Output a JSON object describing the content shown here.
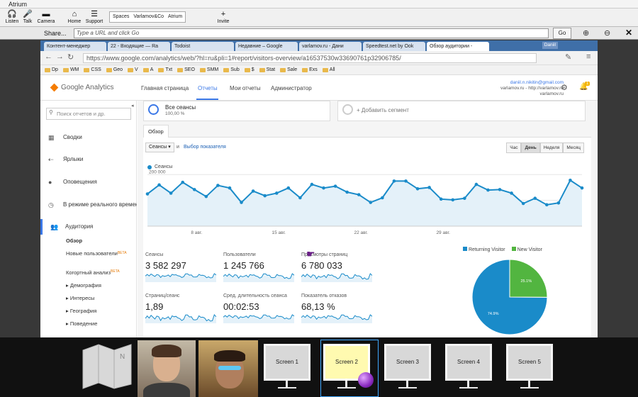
{
  "app": {
    "title": "Atrium",
    "toolbar": [
      "Listen",
      "Talk",
      "Camera",
      "Home",
      "Support",
      "Invite"
    ],
    "breadcrumb": [
      "Spaces",
      "Varlamov&Co",
      "Atrium"
    ],
    "share_label": "Share...",
    "url_placeholder": "Type a URL and click Go",
    "go_label": "Go"
  },
  "browser": {
    "tabs": [
      "Контент-менеджер",
      "22 - Входящие — Ra",
      "Todoist",
      "Недавние – Google",
      "varlamov.ru - Дани",
      "Speedtest.net by Ook",
      "Обзор аудитории -"
    ],
    "active_tab_index": 6,
    "user_badge": "Daniil",
    "url": "https://www.google.com/analytics/web/?hl=ru&pli=1#report/visitors-overview/a16537530w33690761p32906785/",
    "url_scheme": "https://",
    "bookmarks": [
      "Dp",
      "WM",
      "CSS",
      "Geo",
      "V",
      "A",
      "Txt",
      "SEO",
      "SMM",
      "Sub",
      "$",
      "Stat",
      "Sale",
      "Exs",
      "All"
    ]
  },
  "ga": {
    "logo_text": "Google Analytics",
    "nav": [
      "Главная страница",
      "Отчеты",
      "Мои отчеты",
      "Администратор"
    ],
    "active_nav": "Отчеты",
    "account": {
      "email": "daniil.n.nikitin@gmail.com",
      "property": "varlamov.ru - http://varlamov.ru",
      "view": "varlamov.ru"
    },
    "notification_count": "1",
    "sidebar": {
      "search_placeholder": "Поиск отчетов и др.",
      "items": [
        "Сводки",
        "Ярлыки",
        "Оповещения",
        "В режиме реального времени",
        "Аудитория"
      ],
      "sub_items": [
        "Обзор",
        "Новые пользователи",
        "Когортный анализ",
        "Демография",
        "Интересы",
        "География",
        "Поведение"
      ],
      "beta": "BETA"
    },
    "segment": {
      "title": "Все сеансы",
      "percent": "100,00 %",
      "add_label": "+ Добавить сегмент"
    },
    "overview_tab": "Обзор",
    "metric_select": "Сеансы",
    "and_label": "и",
    "choose_metric": "Выбор показателя",
    "time_buttons": [
      "Час",
      "День",
      "Неделя",
      "Месяц"
    ],
    "active_time": "День",
    "metrics": [
      {
        "label": "Сеансы",
        "value": "3 582 297"
      },
      {
        "label": "Пользователи",
        "value": "1 245 766"
      },
      {
        "label": "Просмотры страниц",
        "value": "6 780 033"
      },
      {
        "label": "Страниц/сеанс",
        "value": "1,89"
      },
      {
        "label": "Сред. длительность сеанса",
        "value": "00:02:53"
      },
      {
        "label": "Показатель отказов",
        "value": "68,13 %"
      }
    ],
    "pie": {
      "legend": [
        "Returning Visitor",
        "New Visitor"
      ],
      "values": [
        74.9,
        25.1
      ],
      "labels": [
        "74.9%",
        "25.1%"
      ],
      "colors": [
        "#1a8bc9",
        "#52b540"
      ]
    }
  },
  "chart_data": {
    "type": "area",
    "series": [
      {
        "name": "Сеансы",
        "values": [
          125000,
          160000,
          128000,
          170000,
          142000,
          115000,
          158000,
          148000,
          92000,
          136000,
          118000,
          128000,
          148000,
          110000,
          162000,
          148000,
          155000,
          132000,
          122000,
          92000,
          110000,
          175000,
          175000,
          145000,
          150000,
          105000,
          102000,
          108000,
          162000,
          140000,
          142000,
          128000,
          88000,
          108000,
          83000,
          90000,
          178000,
          148000
        ]
      }
    ],
    "x_tick_labels": [
      "8 авг.",
      "15 авг.",
      "22 авг.",
      "29 авг."
    ],
    "y_tick_labels": [
      "200 000",
      "100 000"
    ],
    "ylim": [
      0,
      220000
    ],
    "color": "#1a8bc9"
  },
  "bottom_bar": {
    "screens": [
      "Screen 1",
      "Screen 2",
      "Screen 3",
      "Screen 4",
      "Screen 5"
    ],
    "active_screen": "Screen 2"
  }
}
